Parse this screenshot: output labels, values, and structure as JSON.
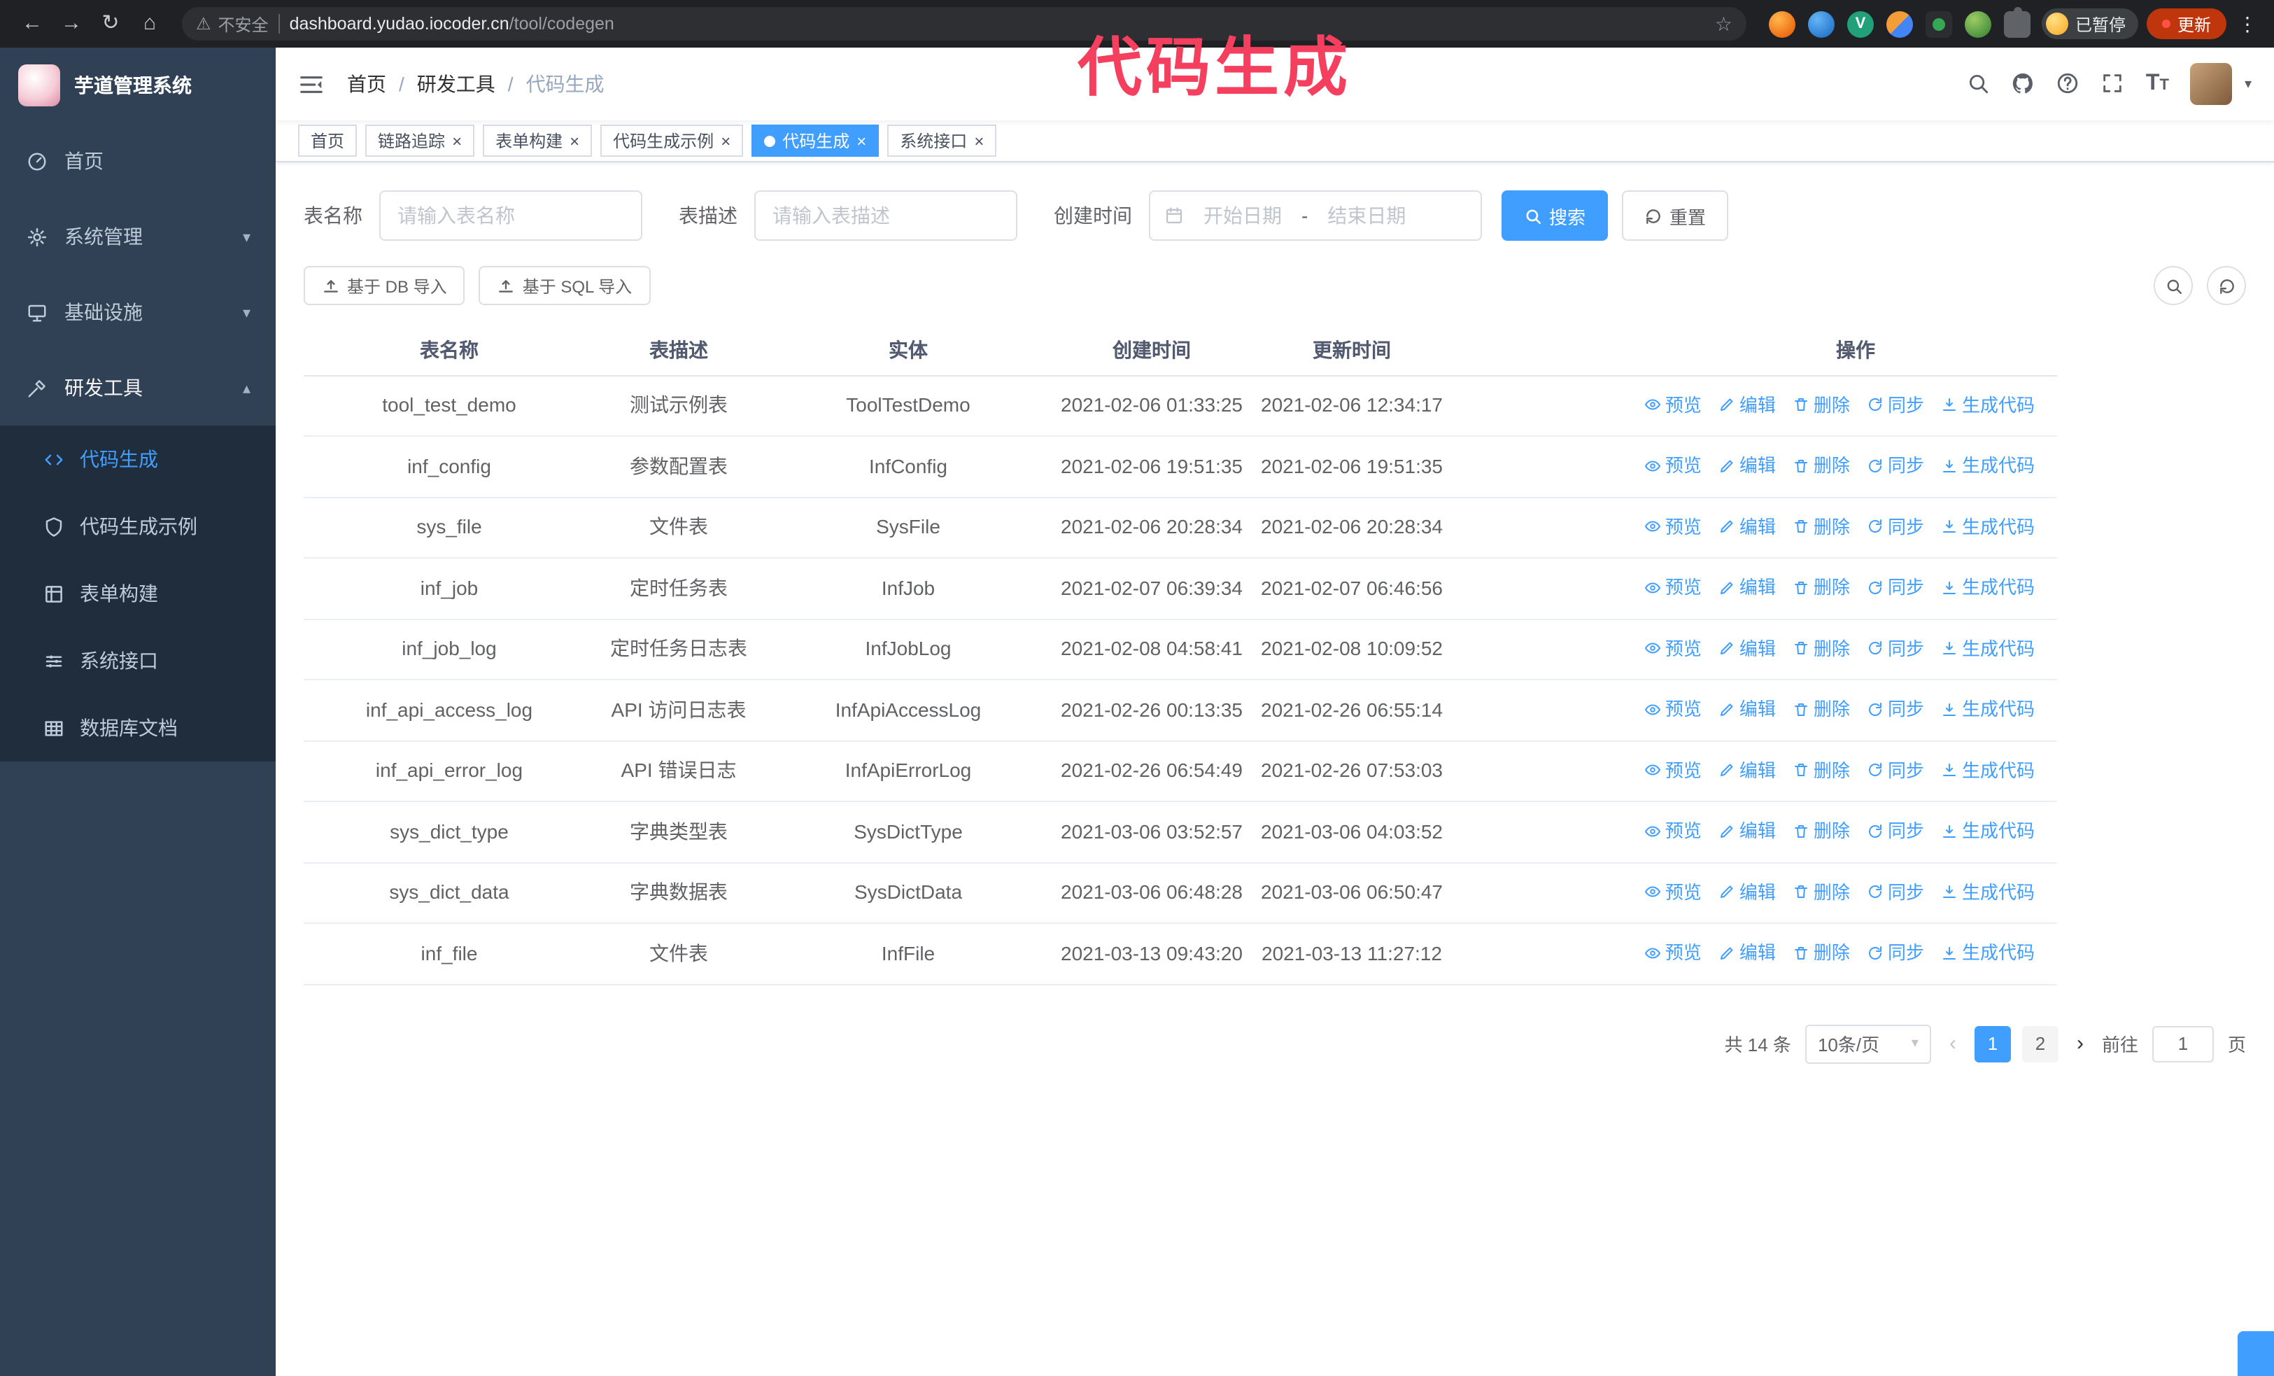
{
  "browser": {
    "security_warning": "不安全",
    "url_domain": "dashboard.yudao.iocoder.cn",
    "url_path": "/tool/codegen",
    "paused_badge": "已暂停",
    "update_button": "更新"
  },
  "annotation": "代码生成",
  "sidebar": {
    "logo_title": "芋道管理系统",
    "items": [
      {
        "label": "首页",
        "icon": "dashboard-icon",
        "expandable": false,
        "expanded": false
      },
      {
        "label": "系统管理",
        "icon": "gear-icon",
        "expandable": true,
        "expanded": false
      },
      {
        "label": "基础设施",
        "icon": "monitor-icon",
        "expandable": true,
        "expanded": false
      },
      {
        "label": "研发工具",
        "icon": "tools-icon",
        "expandable": true,
        "expanded": true
      }
    ],
    "subitems": [
      {
        "label": "代码生成",
        "icon": "code-icon",
        "active": true
      },
      {
        "label": "代码生成示例",
        "icon": "example-icon",
        "active": false
      },
      {
        "label": "表单构建",
        "icon": "form-icon",
        "active": false
      },
      {
        "label": "系统接口",
        "icon": "api-icon",
        "active": false
      },
      {
        "label": "数据库文档",
        "icon": "database-icon",
        "active": false
      }
    ]
  },
  "header": {
    "breadcrumb": [
      "首页",
      "研发工具",
      "代码生成"
    ]
  },
  "tabs": [
    {
      "label": "首页",
      "closable": false,
      "active": false
    },
    {
      "label": "链路追踪",
      "closable": true,
      "active": false
    },
    {
      "label": "表单构建",
      "closable": true,
      "active": false
    },
    {
      "label": "代码生成示例",
      "closable": true,
      "active": false
    },
    {
      "label": "代码生成",
      "closable": true,
      "active": true
    },
    {
      "label": "系统接口",
      "closable": true,
      "active": false
    }
  ],
  "filters": {
    "table_name_label": "表名称",
    "table_name_placeholder": "请输入表名称",
    "table_desc_label": "表描述",
    "table_desc_placeholder": "请输入表描述",
    "create_time_label": "创建时间",
    "start_date_placeholder": "开始日期",
    "range_separator": "-",
    "end_date_placeholder": "结束日期",
    "search_button": "搜索",
    "reset_button": "重置"
  },
  "toolbar": {
    "import_db_button": "基于 DB 导入",
    "import_sql_button": "基于 SQL 导入"
  },
  "table": {
    "columns": [
      "表名称",
      "表描述",
      "实体",
      "创建时间",
      "更新时间",
      "操作"
    ],
    "row_actions": [
      {
        "label": "预览",
        "icon": "eye-icon"
      },
      {
        "label": "编辑",
        "icon": "edit-icon"
      },
      {
        "label": "删除",
        "icon": "delete-icon"
      },
      {
        "label": "同步",
        "icon": "sync-icon"
      },
      {
        "label": "生成代码",
        "icon": "download-icon"
      }
    ],
    "rows": [
      {
        "name": "tool_test_demo",
        "desc": "测试示例表",
        "entity": "ToolTestDemo",
        "created": "2021-02-06 01:33:25",
        "updated": "2021-02-06 12:34:17"
      },
      {
        "name": "inf_config",
        "desc": "参数配置表",
        "entity": "InfConfig",
        "created": "2021-02-06 19:51:35",
        "updated": "2021-02-06 19:51:35"
      },
      {
        "name": "sys_file",
        "desc": "文件表",
        "entity": "SysFile",
        "created": "2021-02-06 20:28:34",
        "updated": "2021-02-06 20:28:34"
      },
      {
        "name": "inf_job",
        "desc": "定时任务表",
        "entity": "InfJob",
        "created": "2021-02-07 06:39:34",
        "updated": "2021-02-07 06:46:56"
      },
      {
        "name": "inf_job_log",
        "desc": "定时任务日志表",
        "entity": "InfJobLog",
        "created": "2021-02-08 04:58:41",
        "updated": "2021-02-08 10:09:52"
      },
      {
        "name": "inf_api_access_log",
        "desc": "API 访问日志表",
        "entity": "InfApiAccessLog",
        "created": "2021-02-26 00:13:35",
        "updated": "2021-02-26 06:55:14"
      },
      {
        "name": "inf_api_error_log",
        "desc": "API 错误日志",
        "entity": "InfApiErrorLog",
        "created": "2021-02-26 06:54:49",
        "updated": "2021-02-26 07:53:03"
      },
      {
        "name": "sys_dict_type",
        "desc": "字典类型表",
        "entity": "SysDictType",
        "created": "2021-03-06 03:52:57",
        "updated": "2021-03-06 04:03:52"
      },
      {
        "name": "sys_dict_data",
        "desc": "字典数据表",
        "entity": "SysDictData",
        "created": "2021-03-06 06:48:28",
        "updated": "2021-03-06 06:50:47"
      },
      {
        "name": "inf_file",
        "desc": "文件表",
        "entity": "InfFile",
        "created": "2021-03-13 09:43:20",
        "updated": "2021-03-13 11:27:12"
      }
    ]
  },
  "pagination": {
    "total_text": "共 14 条",
    "page_size": "10条/页",
    "pages": [
      "1",
      "2"
    ],
    "active_page": "1",
    "goto_label": "前往",
    "goto_value": "1",
    "goto_suffix": "页"
  },
  "colors": {
    "primary": "#409eff",
    "active_tab": "#409eff",
    "annotation": "#f43f5e"
  }
}
